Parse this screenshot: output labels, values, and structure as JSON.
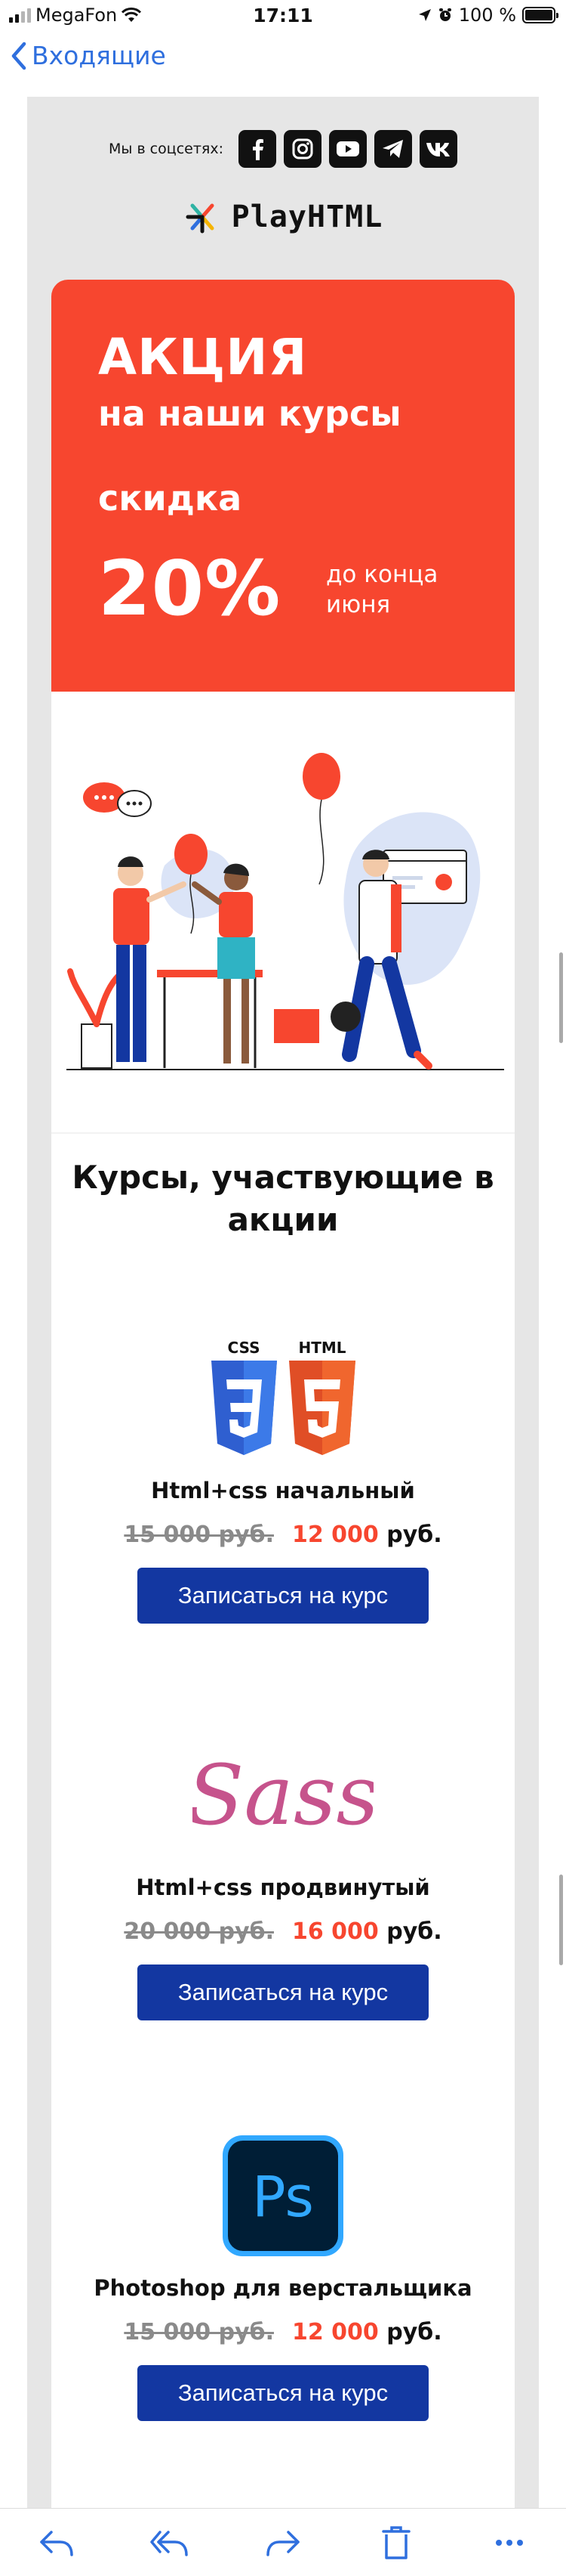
{
  "status_bar": {
    "carrier": "MegaFon",
    "time": "17:11",
    "battery": "100 %"
  },
  "nav": {
    "back_label": "Входящие"
  },
  "email": {
    "social_label": "Мы в соцсетях:",
    "social_icons": [
      "facebook-icon",
      "instagram-icon",
      "youtube-icon",
      "telegram-icon",
      "vk-icon"
    ],
    "logo_text": "PlayHTML",
    "promo": {
      "title": "АКЦИЯ",
      "subtitle": "на наши курсы",
      "discount_label": "скидка",
      "percent": "20%",
      "until": "до конца июня"
    },
    "section_title": "Курсы, участвующие в акции",
    "courses": [
      {
        "title": "Html+css начальный",
        "old_price": "15 000 руб.",
        "new_price": "12 000",
        "currency": "руб.",
        "button": "Записаться на курс",
        "logo_css": "CSS",
        "logo_html": "HTML"
      },
      {
        "title": "Html+css продвинутый",
        "old_price": "20 000 руб.",
        "new_price": "16 000",
        "currency": "руб.",
        "button": "Записаться на курс",
        "logo_text": "Sass"
      },
      {
        "title": "Photoshop для верстальщика",
        "old_price": "15 000 руб.",
        "new_price": "12 000",
        "currency": "руб.",
        "button": "Записаться на курс",
        "logo_text": "Ps"
      }
    ]
  },
  "toolbar": [
    "reply-icon",
    "reply-all-icon",
    "forward-icon",
    "trash-icon",
    "more-icon"
  ],
  "colors": {
    "accent": "#f7462f",
    "button": "#1337a1",
    "ios_blue": "#2f6fde"
  }
}
